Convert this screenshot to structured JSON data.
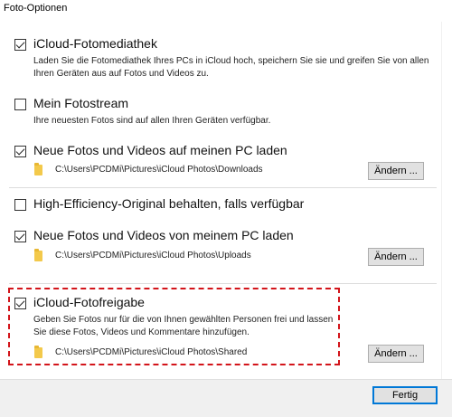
{
  "window": {
    "title": "Foto-Optionen"
  },
  "options": [
    {
      "title": "iCloud-Fotomediathek",
      "checked": true,
      "description": "Laden Sie die Fotomediathek Ihres PCs in iCloud hoch, speichern Sie sie und greifen Sie von allen Ihren Geräten aus auf Fotos und Videos zu."
    },
    {
      "title": "Mein Fotostream",
      "checked": false,
      "description": "Ihre neuesten Fotos sind auf allen Ihren Geräten verfügbar."
    },
    {
      "title": "Neue Fotos und Videos auf meinen PC laden",
      "checked": true,
      "path": "C:\\Users\\PCDMi\\Pictures\\iCloud Photos\\Downloads",
      "button": "Ändern ..."
    },
    {
      "title": "High-Efficiency-Original behalten, falls verfügbar",
      "checked": false
    },
    {
      "title": "Neue Fotos und Videos von meinem PC laden",
      "checked": true,
      "path": "C:\\Users\\PCDMi\\Pictures\\iCloud Photos\\Uploads",
      "button": "Ändern ..."
    },
    {
      "title": "iCloud-Fotofreigabe",
      "checked": true,
      "description": "Geben Sie Fotos nur für die von Ihnen gewählten Personen frei und lassen Sie diese Fotos, Videos und Kommentare hinzufügen.",
      "path": "C:\\Users\\PCDMi\\Pictures\\iCloud Photos\\Shared",
      "button": "Ändern ..."
    }
  ],
  "footer": {
    "done_label": "Fertig"
  },
  "highlight_color": "#d3141a",
  "accent_color": "#0078d7"
}
